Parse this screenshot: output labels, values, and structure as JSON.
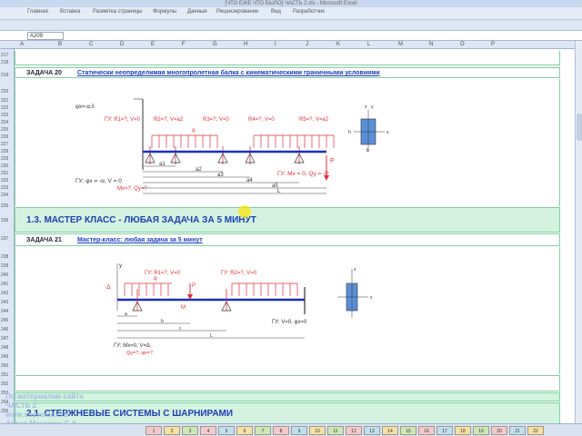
{
  "window": {
    "title": "[ЧТО ЕЖЕ ЧТО БЫЛО] ЧАСТЬ 2.xls - Microsoft Excel"
  },
  "menu": [
    "Главная",
    "Вставка",
    "Разметка страницы",
    "Формулы",
    "Данные",
    "Рецензирование",
    "Вид",
    "Разработчик"
  ],
  "formula_bar": {
    "name_box": "A209"
  },
  "columns": [
    "A",
    "B",
    "C",
    "D",
    "E",
    "F",
    "G",
    "H",
    "I",
    "J",
    "K",
    "L",
    "M",
    "N",
    "O",
    "P"
  ],
  "rows_top": [
    "217",
    "218",
    "219",
    "220",
    "221",
    "222",
    "223",
    "224",
    "225",
    "226",
    "227",
    "228",
    "229",
    "230",
    "231",
    "232",
    "233",
    "234",
    "235",
    "236"
  ],
  "rows_bottom": [
    "237",
    "238",
    "239",
    "240",
    "241",
    "242",
    "243",
    "244",
    "245",
    "246",
    "247",
    "248",
    "249",
    "250",
    "251",
    "252",
    "253",
    "254",
    "255"
  ],
  "task20": {
    "label": "ЗАДАЧА 20",
    "title": "Статически неопределимая многопролетная балка с кинематическими граничными условиями",
    "diagram": {
      "left_label": "φx=-α,δ",
      "bc_top": [
        "ГУ: R1=?, V=0",
        "R2=?, V=a2",
        "R3=?, V=0",
        "R4=?, V=0",
        "R5=?, V=a2"
      ],
      "spans": [
        "a1",
        "a2",
        "a3",
        "a4",
        "a5",
        "L"
      ],
      "bc_bottom_left": "ГУ: φx = -α, V = 0",
      "bc_bottom_left2": "Mx=?,  Qy=?",
      "bc_right": "ГУ: Mx = 0, Qy = -P",
      "load_p": "P",
      "load_q": "q",
      "section": {
        "b": "b",
        "h": "h",
        "z": "z",
        "y": "y",
        "x": "x"
      }
    }
  },
  "section13": {
    "heading": "1.3. МАСТЕР КЛАСС - ЛЮБАЯ ЗАДАЧА ЗА 5 МИНУТ"
  },
  "task21": {
    "label": "ЗАДАЧА 21",
    "title": "Мастер-класс:  любая задача за 5 минут",
    "diagram": {
      "bc_top": [
        "ГУ: R1=?, V=0",
        "ГУ: R2=?, V=0"
      ],
      "bc_bottom_left": "ГУ: Mx=0, V=Δ",
      "bc_bottom_left2": "Qy=?, φx=?",
      "bc_right": "ГУ: V=0, φx=0",
      "labels": [
        "Δ",
        "q",
        "M",
        "P",
        "a",
        "b",
        "c",
        "L",
        "y",
        "z",
        "x"
      ]
    }
  },
  "section21": {
    "heading": "2.1. СТЕРЖНЕВЫЕ СИСТЕМЫ С ШАРНИРАМИ"
  },
  "watermark": {
    "line1": "По материалам сайта",
    "line2": "ЧАСТЬ 2",
    "line3": "www.sopromex.ru",
    "line4": "Автор Мантиеш С.А."
  },
  "sheet_tabs": [
    "1",
    "2",
    "3",
    "4",
    "5",
    "6",
    "7",
    "8",
    "9",
    "10",
    "11",
    "12",
    "13",
    "14",
    "15",
    "16",
    "17",
    "18",
    "19",
    "20",
    "21",
    "22"
  ],
  "colors": {
    "accent": "#1d3fb8",
    "band": "#d3f3e0",
    "load": "#e0303a",
    "beam": "#1a2fc8"
  }
}
